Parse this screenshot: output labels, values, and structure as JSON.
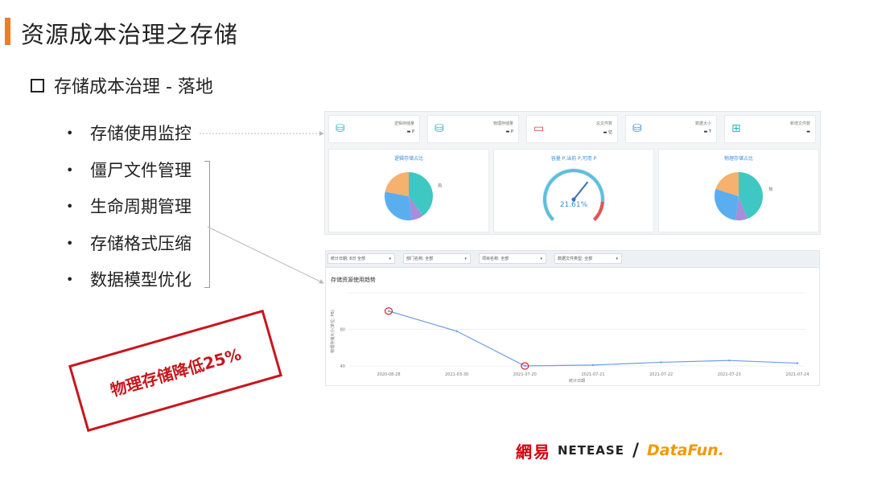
{
  "header": {
    "title": "资源成本治理之存储",
    "subtitle": "存储成本治理 - 落地",
    "accent_color": "#ef7d22"
  },
  "bullets": [
    {
      "dot": "•",
      "text": "存储使用监控"
    },
    {
      "dot": "•",
      "text": "僵尸文件管理"
    },
    {
      "dot": "•",
      "text": "生命周期管理"
    },
    {
      "dot": "•",
      "text": "存储格式压缩"
    },
    {
      "dot": "•",
      "text": "数据模型优化"
    }
  ],
  "stamp": {
    "text": "物理存储降低25%",
    "color": "#c8161d"
  },
  "dashboard": {
    "cards": [
      {
        "icon": "database-icon",
        "label": "逻辑存储量",
        "value": "▬ P",
        "color": "#2fb8b8"
      },
      {
        "icon": "database-icon",
        "label": "物理存储量",
        "value": "▬ P",
        "color": "#2fb8b8"
      },
      {
        "icon": "folder-icon",
        "label": "总文件数",
        "value": "▬ 亿",
        "color": "#e0403a"
      },
      {
        "icon": "database-icon",
        "label": "数据大小",
        "value": "▬ T",
        "color": "#3b8fd6"
      },
      {
        "icon": "folder-plus-icon",
        "label": "新增文件数",
        "value": "▬",
        "color": "#2fb8b8"
      }
    ],
    "panels": [
      {
        "title": "逻辑存储占比",
        "type": "pie",
        "slices": [
          {
            "label": "热",
            "value": 40,
            "color": "#3ec7c3"
          },
          {
            "label": "",
            "value": 8,
            "color": "#a68ed8"
          },
          {
            "label": "",
            "value": 30,
            "color": "#5aaef0"
          },
          {
            "label": "",
            "value": 22,
            "color": "#f5b16d"
          }
        ]
      },
      {
        "title": "容量 P,当前 P,可用 P",
        "type": "gauge",
        "percent": 21.61,
        "label": "21.61%"
      },
      {
        "title": "物理存储占比",
        "type": "pie",
        "slices": [
          {
            "label": "热",
            "value": 44,
            "color": "#3ec7c3"
          },
          {
            "label": "",
            "value": 8,
            "color": "#a68ed8"
          },
          {
            "label": "",
            "value": 28,
            "color": "#5aaef0"
          },
          {
            "label": "",
            "value": 20,
            "color": "#f5b16d"
          }
        ]
      }
    ]
  },
  "trend": {
    "filters": [
      {
        "label": "统计日期: 8日 全部"
      },
      {
        "label": "部门名称: 全部"
      },
      {
        "label": "项目名称: 全部"
      },
      {
        "label": "数据文件类型: 全部"
      }
    ],
    "title": "存储资源使用趋势",
    "chart_data": {
      "type": "line",
      "x": [
        "2020-08-28",
        "2021-03-30",
        "2021-07-20",
        "2021-07-21",
        "2021-07-22",
        "2021-07-23",
        "2021-07-24"
      ],
      "series": [
        {
          "values": [
            100,
            78,
            40,
            41,
            44,
            46,
            43
          ]
        }
      ],
      "ylim": [
        40,
        120
      ],
      "yticks": [
        "",
        "80",
        "40"
      ],
      "xlabel": "统计日期",
      "ylabel": "物理存储大小(单位: PB)",
      "line_color": "#6f9ce6",
      "highlighted_points": [
        0,
        2
      ],
      "highlight_color": "#d81e24"
    }
  },
  "footer": {
    "logo_netease_cn": "網易",
    "logo_netease_en": "NetEase",
    "logo_slash": "/",
    "logo_datafun": "DataFun."
  }
}
